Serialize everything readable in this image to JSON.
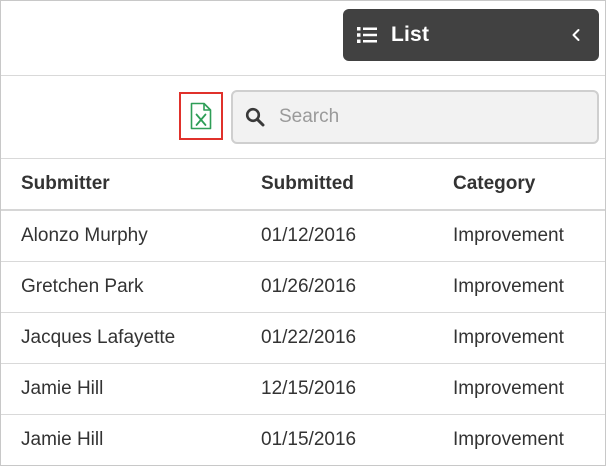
{
  "header": {
    "view_toggle_label": "List"
  },
  "toolbar": {
    "search_placeholder": "Search",
    "search_value": ""
  },
  "table": {
    "columns": [
      "Submitter",
      "Submitted",
      "Category"
    ],
    "rows": [
      [
        "Alonzo Murphy",
        "01/12/2016",
        "Improvement"
      ],
      [
        "Gretchen Park",
        "01/26/2016",
        "Improvement"
      ],
      [
        "Jacques Lafayette",
        "01/22/2016",
        "Improvement"
      ],
      [
        "Jamie Hill",
        "12/15/2016",
        "Improvement"
      ],
      [
        "Jamie Hill",
        "01/15/2016",
        "Improvement"
      ]
    ]
  },
  "colors": {
    "header_dark": "#414141",
    "excel_green": "#2e9e57",
    "highlight_red": "#e0312b"
  }
}
